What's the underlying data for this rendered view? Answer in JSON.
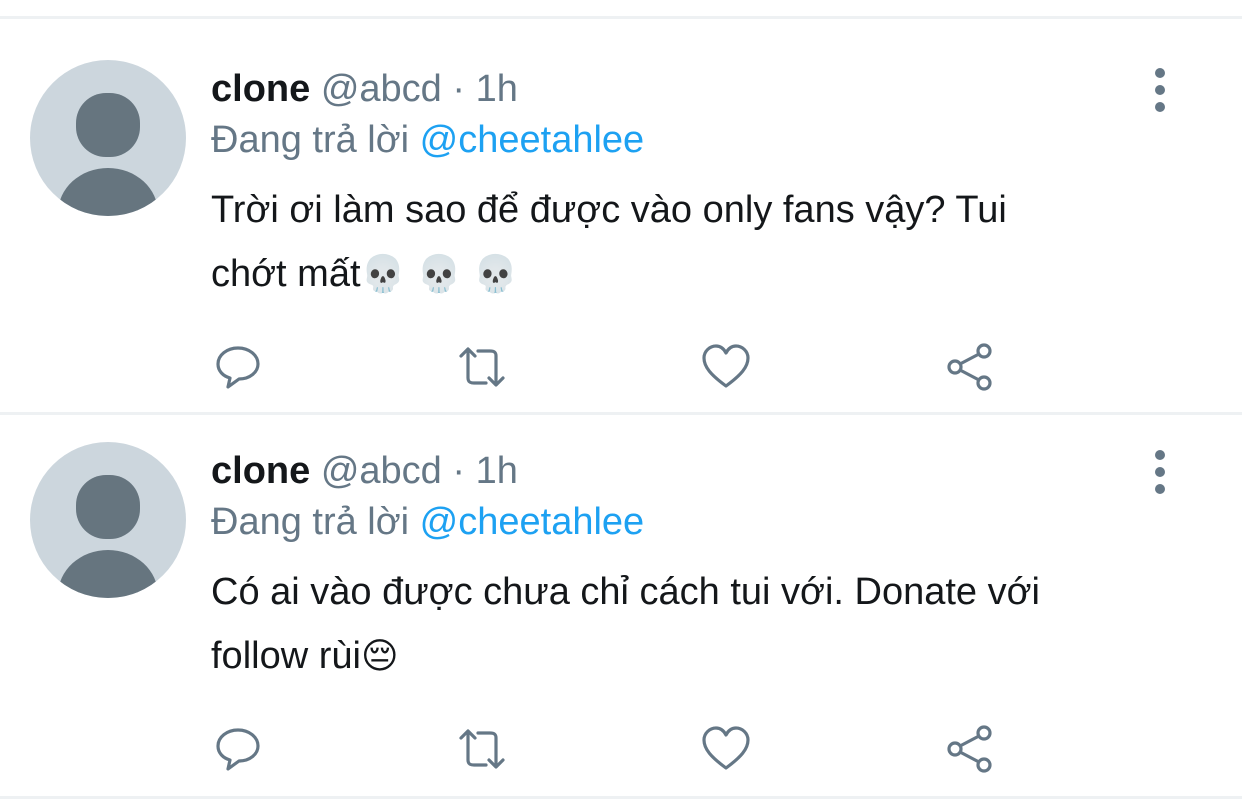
{
  "tweets": [
    {
      "name": "clone",
      "handle": "@abcd",
      "separator": "·",
      "time": "1h",
      "reply_prefix": "Đang trả lời",
      "reply_to": "@cheetahlee",
      "text_line1": "Trời ơi làm sao để được vào only fans vậy? Tui",
      "text_line2": "chớt mất",
      "emoji": "💀 💀 💀"
    },
    {
      "name": "clone",
      "handle": "@abcd",
      "separator": "·",
      "time": "1h",
      "reply_prefix": "Đang trả lời",
      "reply_to": "@cheetahlee",
      "text_line1": "Có ai vào được chưa chỉ cách tui với. Donate với",
      "text_line2": "follow rùi",
      "emoji": "😔"
    }
  ],
  "colors": {
    "name": "#14171a",
    "secondary": "#657786",
    "accent": "#1da1f2",
    "avatar_bg": "#ccd6dd",
    "divider": "#eef1f3"
  },
  "icons": [
    "reply-icon",
    "retweet-icon",
    "like-icon",
    "share-icon",
    "more-options-icon",
    "default-avatar-icon"
  ]
}
